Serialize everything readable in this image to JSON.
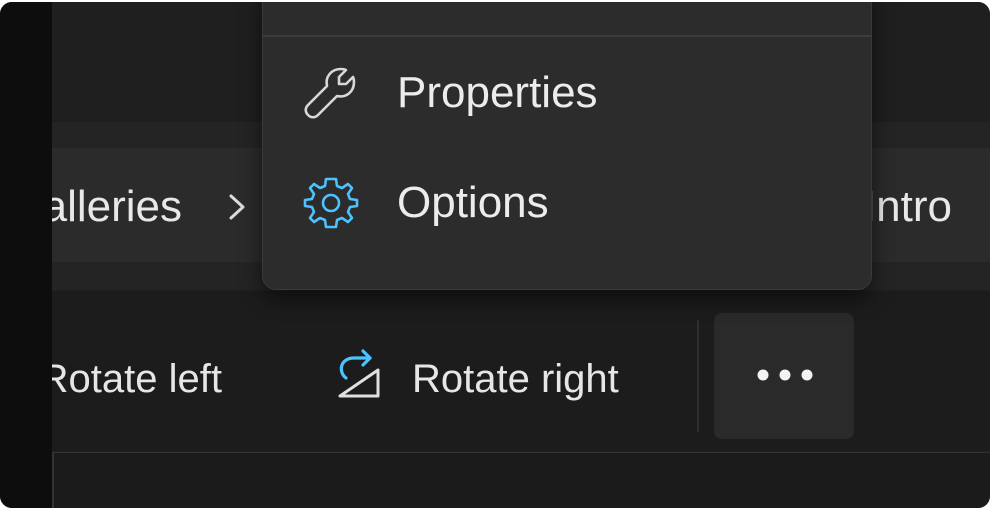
{
  "breadcrumb": {
    "left_label": "Galleries",
    "right_label": "Intro"
  },
  "toolbar": {
    "rotate_left_label": "Rotate left",
    "rotate_right_label": "Rotate right",
    "more_label": "More options"
  },
  "menu": {
    "items": [
      {
        "label": "Properties",
        "icon": "wrench-icon"
      },
      {
        "label": "Options",
        "icon": "gear-icon"
      }
    ]
  },
  "colors": {
    "background": "#202020",
    "menu_background": "#2c2c2c",
    "accent": "#4cc2ff",
    "text": "#ececec"
  }
}
